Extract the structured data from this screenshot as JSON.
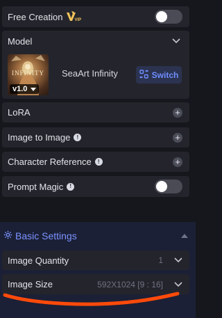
{
  "free_creation": {
    "label": "Free Creation",
    "vip_badge": "VIP",
    "toggle_on": false
  },
  "model": {
    "section_label": "Model",
    "thumbnail_text": "INFINITY",
    "version": "v1.0",
    "name": "SeaArt Infinity",
    "switch_label": "Switch"
  },
  "lora": {
    "label": "LoRA"
  },
  "image_to_image": {
    "label": "Image to Image"
  },
  "character_reference": {
    "label": "Character Reference"
  },
  "prompt_magic": {
    "label": "Prompt Magic",
    "toggle_on": false
  },
  "basic_settings": {
    "title": "Basic Settings",
    "image_quantity": {
      "label": "Image Quantity",
      "value": "1"
    },
    "image_size": {
      "label": "Image Size",
      "value": "592X1024 [9 : 16]"
    }
  },
  "colors": {
    "accent": "#7b92ff",
    "annotation": "#ff4a0a",
    "row_bg": "#24252c",
    "page_bg": "#16171c"
  }
}
